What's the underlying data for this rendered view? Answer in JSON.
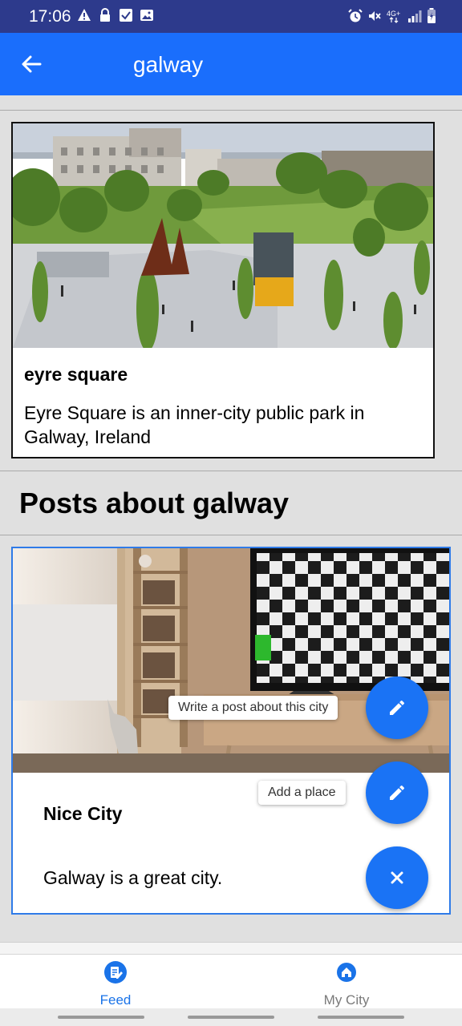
{
  "status_bar": {
    "time": "17:06",
    "bg_color": "#2d3a8c",
    "left_icons": [
      "warning-icon",
      "lock-icon",
      "check-square-icon",
      "image-icon"
    ],
    "right_icons": [
      "alarm-icon",
      "mute-icon",
      "network-4g-icon",
      "signal-icon",
      "battery-icon"
    ],
    "network_label": "4G+"
  },
  "app_bar": {
    "title": "galway",
    "back_icon": "arrow-left-icon",
    "bg_color": "#1a6efc"
  },
  "place": {
    "name": "eyre square",
    "description": "Eyre Square is an inner-city public park in Galway, Ireland",
    "photo": "city-square-photo"
  },
  "posts_section": {
    "heading": "Posts about galway"
  },
  "post": {
    "title": "Nice City",
    "body": "Galway is a great city.",
    "photo": "living-room-photo",
    "border_color": "#2f7be8"
  },
  "fab_menu": {
    "accent_color": "#1a73f5",
    "items": [
      {
        "label": "Write a post about this city",
        "icon": "pencil-icon"
      },
      {
        "label": "Add a place",
        "icon": "pencil-icon"
      }
    ],
    "close_icon": "close-icon"
  },
  "bottom_nav": {
    "active_color": "#1a73e8",
    "items": [
      {
        "label": "Feed",
        "icon": "feed-icon",
        "active": true
      },
      {
        "label": "My City",
        "icon": "home-icon",
        "active": false
      }
    ]
  }
}
